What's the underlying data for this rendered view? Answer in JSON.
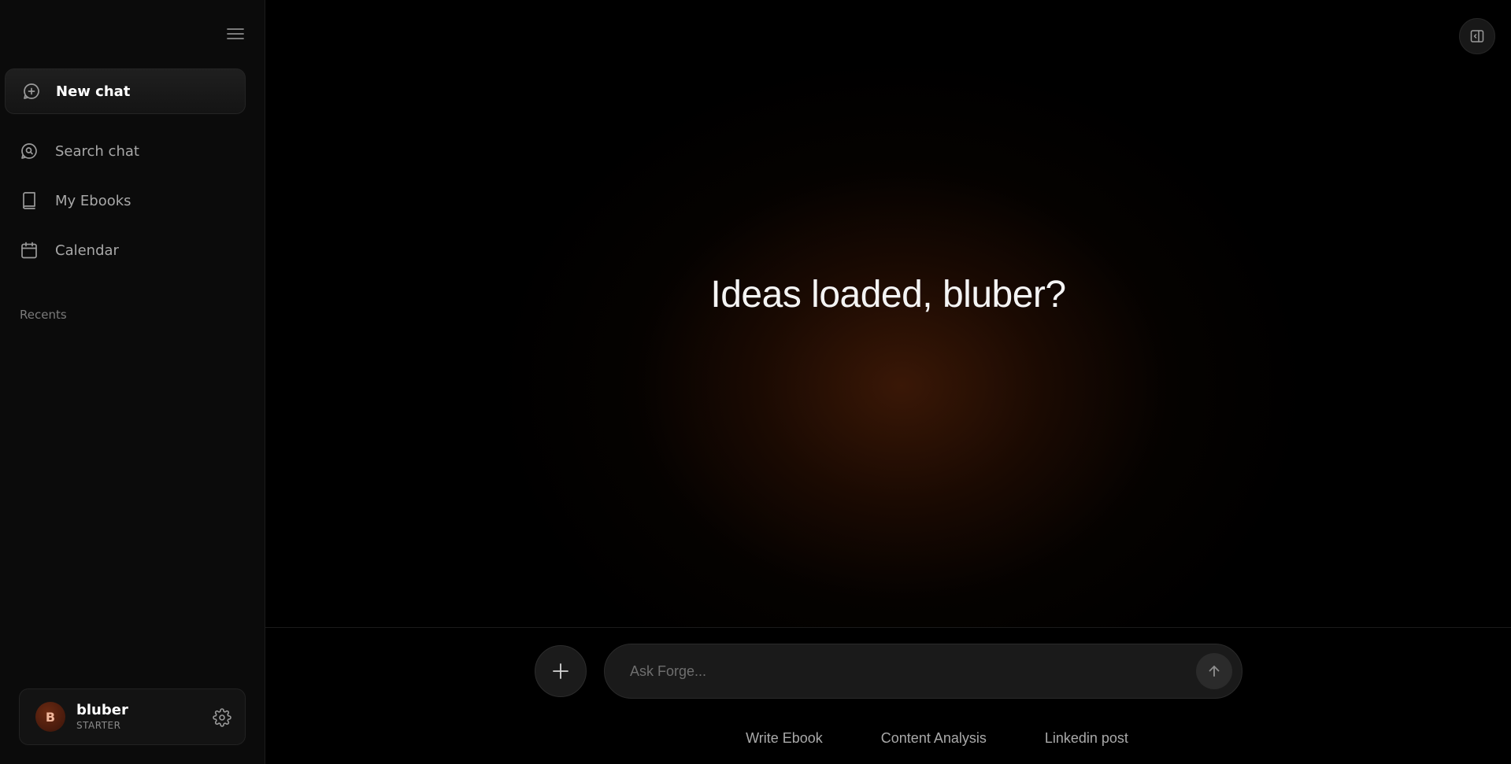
{
  "sidebar": {
    "new_chat": "New chat",
    "items": [
      {
        "label": "Search chat",
        "icon": "search-chat-icon"
      },
      {
        "label": "My Ebooks",
        "icon": "book-icon"
      },
      {
        "label": "Calendar",
        "icon": "calendar-icon"
      }
    ],
    "recents_label": "Recents",
    "user": {
      "initial": "B",
      "name": "bluber",
      "plan": "STARTER"
    }
  },
  "main": {
    "greeting": "Ideas loaded, bluber?",
    "composer": {
      "placeholder": "Ask Forge..."
    },
    "suggestions": [
      "Write Ebook",
      "Content Analysis",
      "Linkedin post"
    ]
  },
  "colors": {
    "accent_glow": "#4a1e08",
    "background": "#000000",
    "sidebar_bg": "#0b0b0b"
  }
}
